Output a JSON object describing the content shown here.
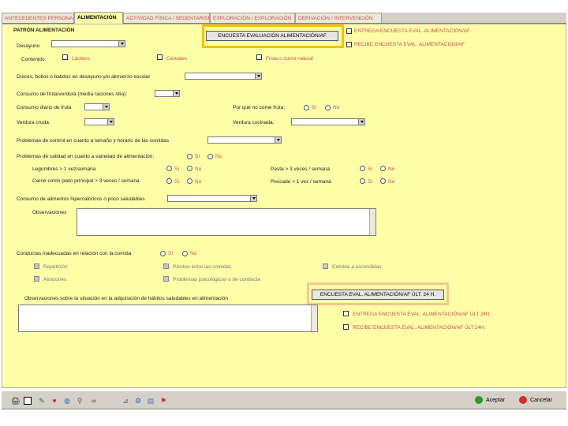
{
  "tabs": [
    "ANTECEDENTES PERSONALES",
    "ALIMENTACIÓN",
    "ACTIVIDAD FÍSICA / SEDENTARISMO",
    "EXPLORACIÓN / EXPLORACIÓN",
    "DERIVACIÓN / INTERVENCIÓN"
  ],
  "sections": {
    "patron": "PATRÓN ALIMENTACIÓN",
    "desayuno": "Desayuno",
    "contenido": "Contenido:",
    "lacteos": "Lácteos",
    "cereales": "Cereales",
    "fruta": "Fruta o zumo natural",
    "dulces": "Dulces, bollos o batidos en desayuno y/o almuerzo escolar",
    "consumo_fruta": "Consumo de fruta/verdura (media raciones /día):",
    "diario_fruta": "Consumo diario de fruta",
    "verdura_cruda": "Verdura cruda",
    "porque_fruta": "Por qué no come fruta:",
    "verdura_cocinada": "Verdura cocinada:",
    "problemas_control": "Problemas de control en cuanto a tamaño y horario de las comidas",
    "problemas_calidad": "Problemas de calidad en cuanto a variedad de alimentación:",
    "legumbres": "Legumbres > 1 vez/semana",
    "carne": "Carne como plato principal > 3 veces / semana",
    "pasta": "Pasta > 3 veces / semana",
    "pescado": "Pescado > 1 vez / semana",
    "hipercaloricos": "Consumo de alimentos hipercalóricos o poco saludables",
    "observaciones": "Observaciones",
    "conductas": "Conductas inadecuadas en relación con la comida",
    "repeticion": "Repetición",
    "picoteo": "Picoteo entre las comidas",
    "comida_escondidas": "Comida a escondidas",
    "atracones": "Atracones",
    "problemas_psico": "Problemas psicológicos o de conducta",
    "obs_situacion": "Observaciones sobre la situación en la adquisición de hábitos saludables en alimentación"
  },
  "options": {
    "si": "Sí",
    "no": "No"
  },
  "buttons": {
    "encuesta": "ENCUESTA EVALUACIÓN ALIMENTACIÓN/AF",
    "encuesta24": "ENCUESTA EVAL. ALIMENTACIÓN/AF ÚLT. 24 H.",
    "aceptar": "Aceptar",
    "cancelar": "Cancelar"
  },
  "side_checks": {
    "entrega": "ENTREGA ENCUESTA EVAL. ALIMENTACIÓN/AF",
    "recibe": "RECIBE ENCUESTA EVAL. ALIMENTACIÓN/AF",
    "entrega24": "ENTREGA ENCUESTA EVAL. ALIMENTACIÓN/AF ÚLT.24H.",
    "recibe24": "RECIBE ENCUESTA EVAL. ALIMENTACIÓN/AF ÚLT.24H."
  },
  "colors": {
    "panel": "#ffffa8",
    "red_text": "#c0504d",
    "highlight_yellow": "#f2c200",
    "highlight_orange": "#f4c690"
  }
}
